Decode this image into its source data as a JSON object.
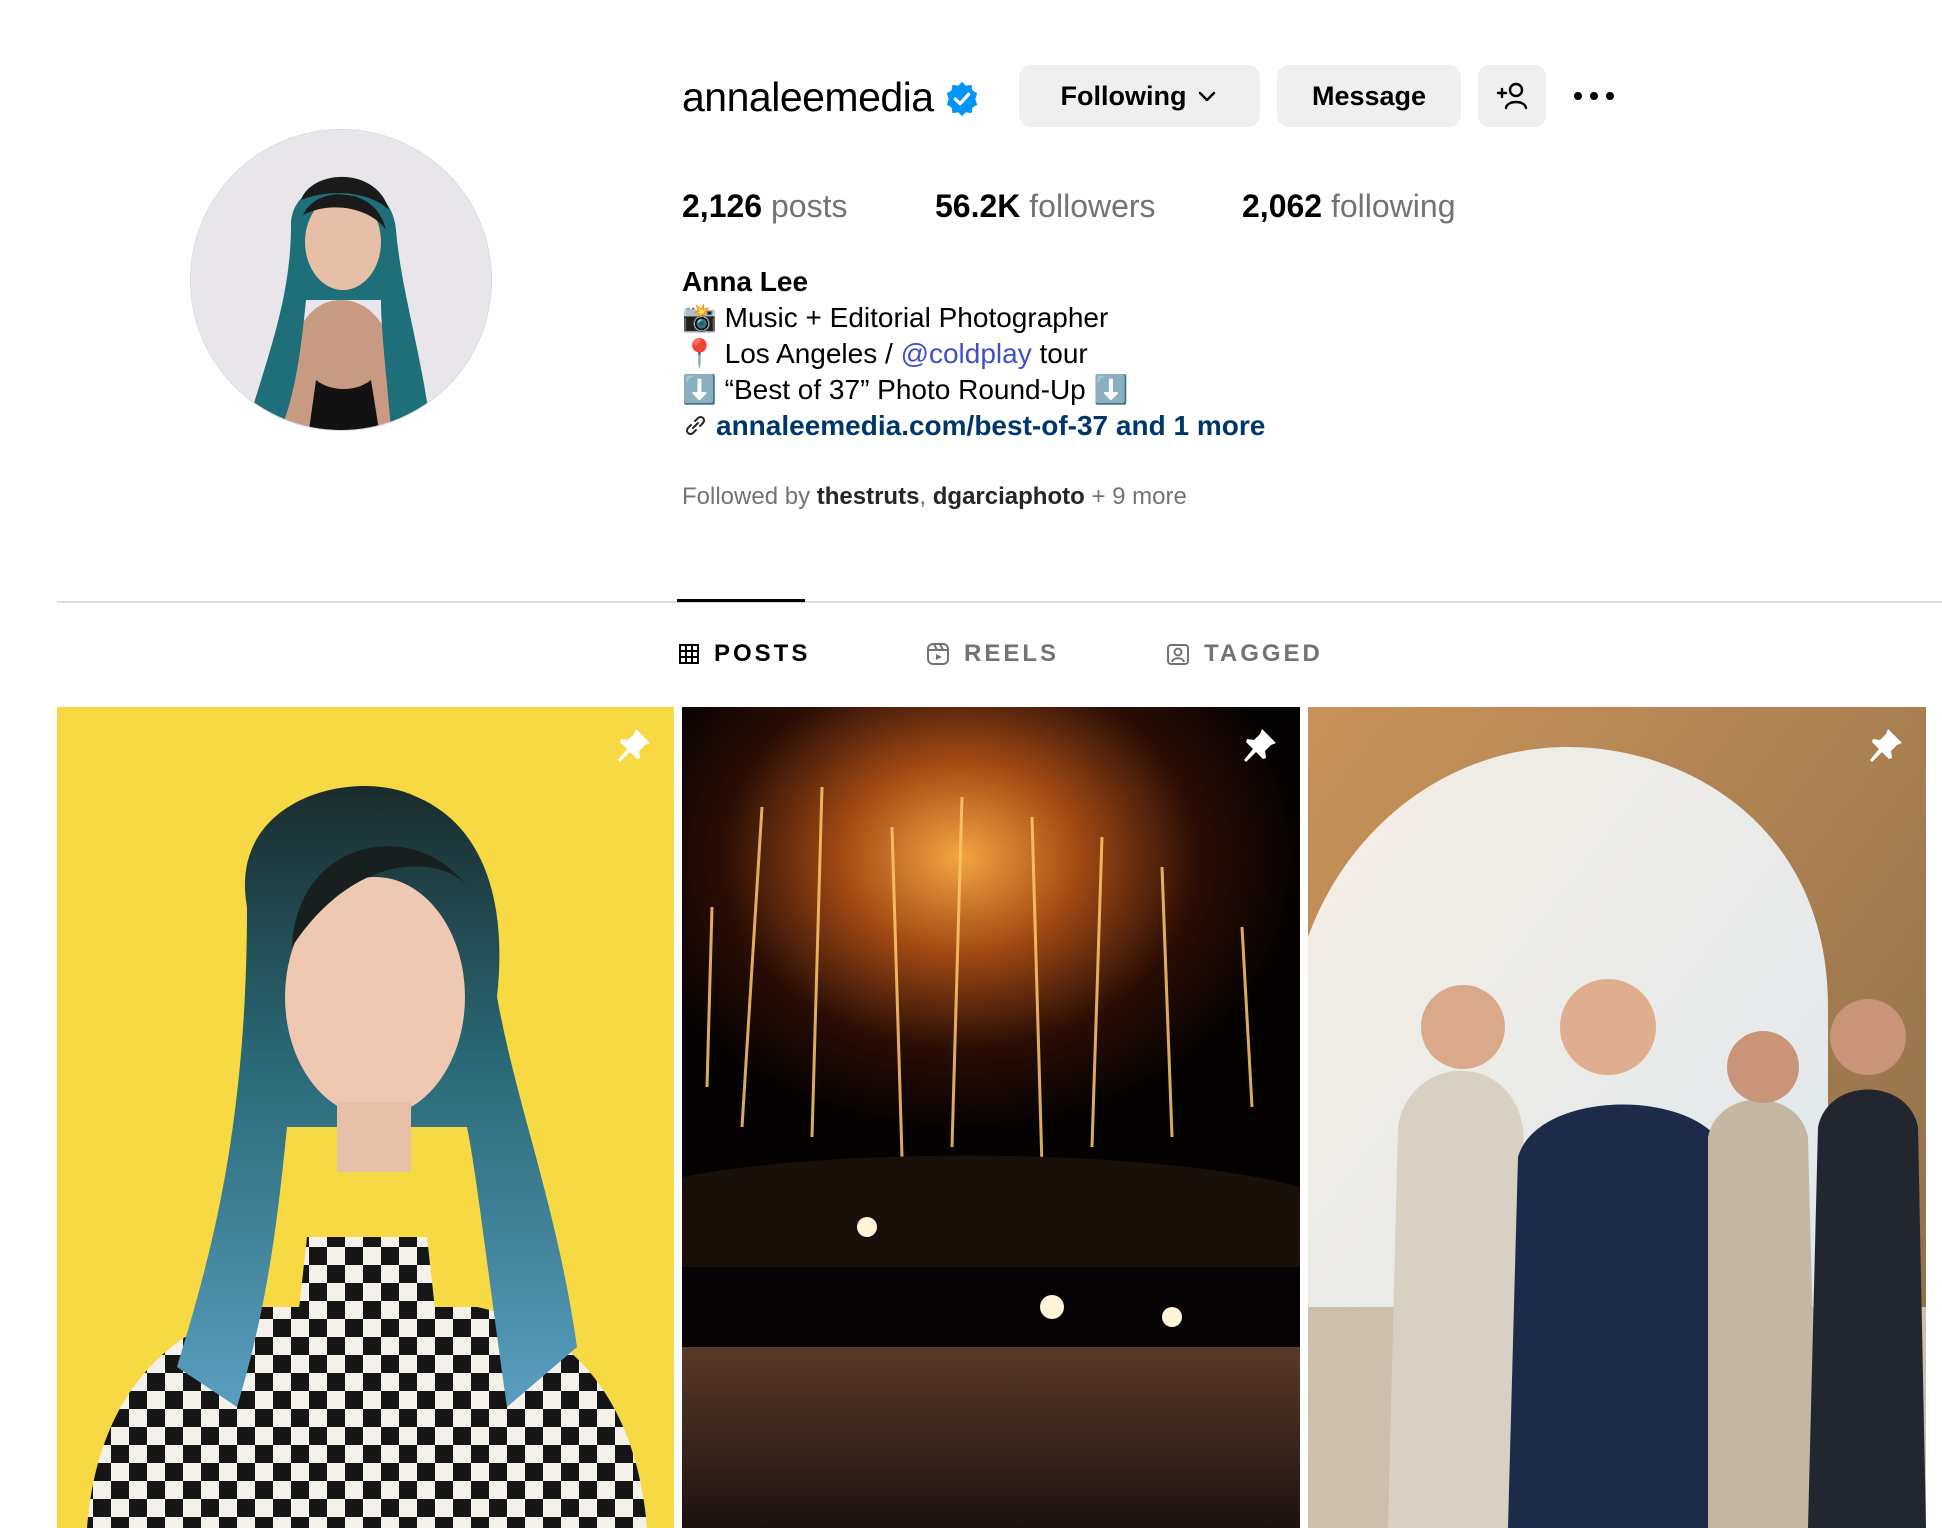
{
  "profile": {
    "username": "annaleemedia",
    "verified": true,
    "buttons": {
      "following": "Following",
      "message": "Message"
    },
    "stats": {
      "posts_count": "2,126",
      "posts_label": "posts",
      "followers_count": "56.2K",
      "followers_label": "followers",
      "following_count": "2,062",
      "following_label": "following"
    },
    "bio": {
      "name": "Anna Lee",
      "line1_emoji": "📸",
      "line1": "Music + Editorial Photographer",
      "line2_emoji": "📍",
      "line2_pre": "Los Angeles / ",
      "line2_mention": "@coldplay",
      "line2_post": " tour",
      "line3_emoji": "⬇️",
      "line3": "“Best of 37” Photo Round-Up",
      "link": "annaleemedia.com/best-of-37 and 1 more"
    },
    "followed_by": {
      "prefix": "Followed by ",
      "user1": "thestruts",
      "sep": ", ",
      "user2": "dgarciaphoto",
      "suffix": " + 9 more"
    }
  },
  "tabs": [
    {
      "label": "POSTS",
      "icon": "grid-icon",
      "active": true
    },
    {
      "label": "REELS",
      "icon": "reels-icon",
      "active": false
    },
    {
      "label": "TAGGED",
      "icon": "tagged-icon",
      "active": false
    }
  ],
  "posts": [
    {
      "pinned": true,
      "icon": "pin-icon"
    },
    {
      "pinned": true,
      "icon": "pin-icon"
    },
    {
      "pinned": true,
      "icon": "pin-icon"
    }
  ],
  "colors": {
    "verified": "#0095f6",
    "mention": "#4150c8",
    "link": "#00376b",
    "button_bg": "#efefef",
    "secondary_text": "#737373"
  }
}
